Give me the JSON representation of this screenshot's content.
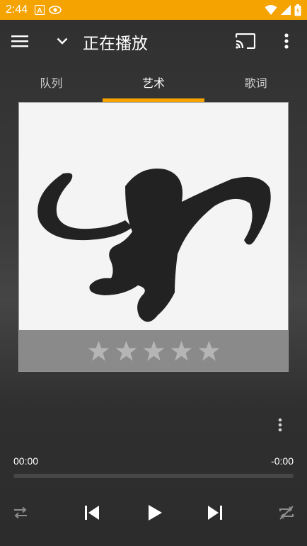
{
  "status_bar": {
    "time": "2:44",
    "icons": [
      "a-notification-icon",
      "eye-notification-icon",
      "wifi-icon",
      "signal-icon",
      "battery-icon"
    ]
  },
  "toolbar": {
    "title": "正在播放",
    "icons": [
      "menu-icon",
      "chevron-down-icon",
      "cast-icon",
      "more-vert-icon"
    ]
  },
  "tabs": [
    {
      "label": "队列",
      "active": false
    },
    {
      "label": "艺术",
      "active": true
    },
    {
      "label": "歌词",
      "active": false
    }
  ],
  "artwork": {
    "description_icon": "monkey-silhouette",
    "rating": 0,
    "rating_max": 5
  },
  "player": {
    "elapsed": "00:00",
    "remaining": "-0:00",
    "progress": 0,
    "controls": [
      "shuffle-icon",
      "previous-icon",
      "play-icon",
      "next-icon",
      "repeat-off-icon"
    ]
  },
  "colors": {
    "accent": "#f5a300",
    "background": "#2f2f2f",
    "rating_bar": "#8a8a8a",
    "star": "#b5b5b5"
  }
}
